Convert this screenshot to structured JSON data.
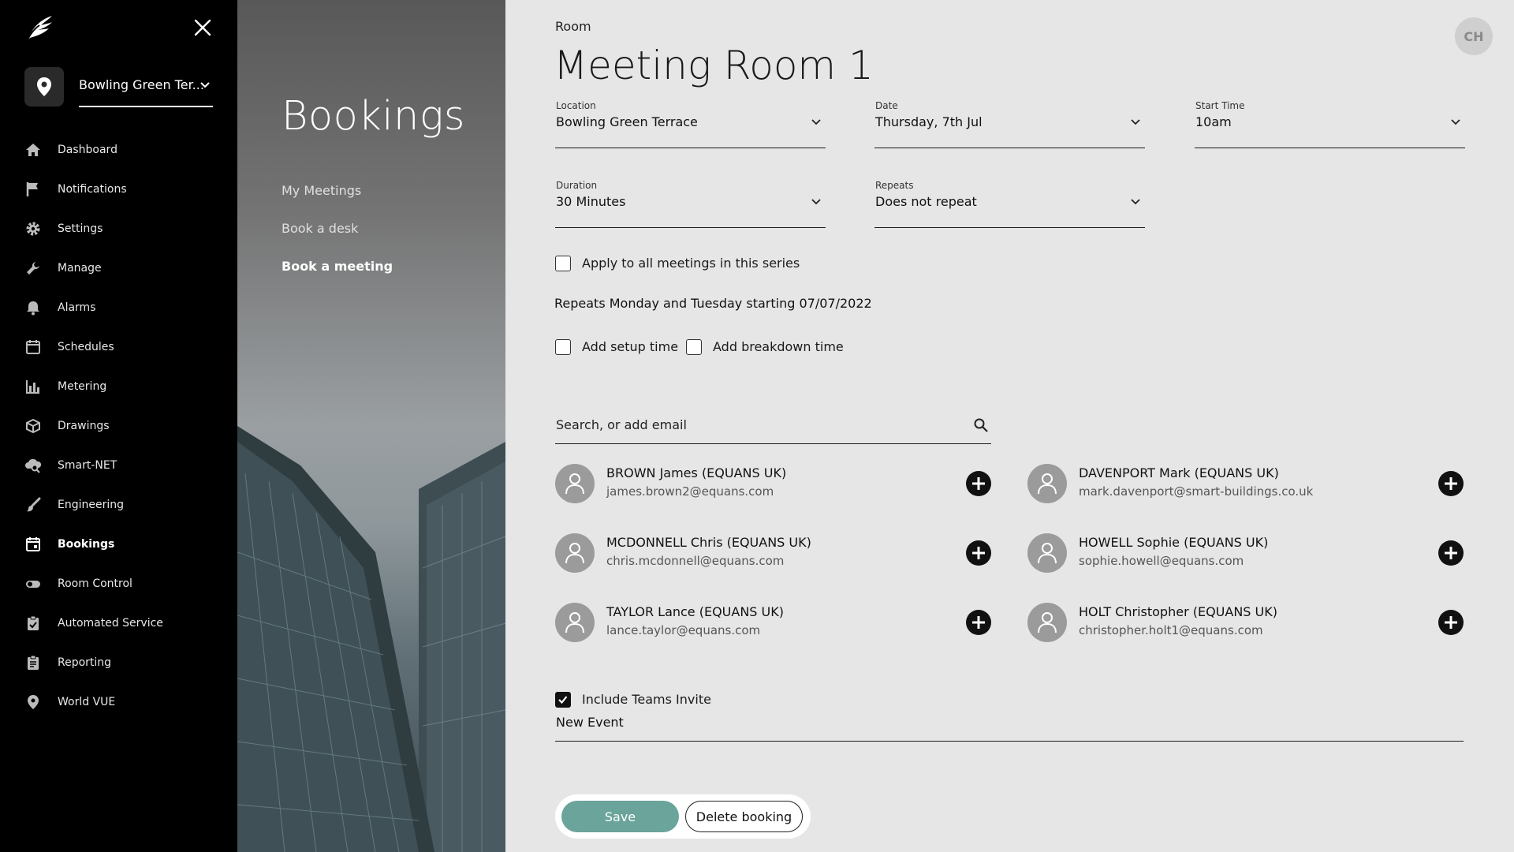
{
  "sidebar": {
    "location_selector": "Bowling Green Ter...",
    "nav": [
      {
        "label": "Dashboard",
        "icon": "home-icon"
      },
      {
        "label": "Notifications",
        "icon": "flag-icon"
      },
      {
        "label": "Settings",
        "icon": "gear-icon"
      },
      {
        "label": "Manage",
        "icon": "wrench-icon"
      },
      {
        "label": "Alarms",
        "icon": "bell-icon"
      },
      {
        "label": "Schedules",
        "icon": "calendar-icon"
      },
      {
        "label": "Metering",
        "icon": "bar-chart-icon"
      },
      {
        "label": "Drawings",
        "icon": "cube-icon"
      },
      {
        "label": "Smart-NET",
        "icon": "cloud-search-icon"
      },
      {
        "label": "Engineering",
        "icon": "brush-icon"
      },
      {
        "label": "Bookings",
        "icon": "calendar-event-icon",
        "active": true
      },
      {
        "label": "Room Control",
        "icon": "toggle-icon"
      },
      {
        "label": "Automated Service",
        "icon": "clipboard-icon"
      },
      {
        "label": "Reporting",
        "icon": "report-icon"
      },
      {
        "label": "World VUE",
        "icon": "map-pin-icon"
      }
    ]
  },
  "bookings_panel": {
    "title": "Bookings",
    "items": [
      {
        "label": "My Meetings"
      },
      {
        "label": "Book a desk"
      },
      {
        "label": "Book a meeting",
        "active": true
      }
    ]
  },
  "form": {
    "room_label": "Room",
    "room_title": "Meeting Room 1",
    "user_initials": "CH",
    "location": {
      "label": "Location",
      "value": "Bowling Green Terrace"
    },
    "date": {
      "label": "Date",
      "value": "Thursday, 7th Jul"
    },
    "start_time": {
      "label": "Start Time",
      "value": "10am"
    },
    "duration": {
      "label": "Duration",
      "value": "30 Minutes"
    },
    "repeats": {
      "label": "Repeats",
      "value": "Does not repeat"
    },
    "apply_series": {
      "label": "Apply to all meetings in this series",
      "checked": false
    },
    "repeat_summary": "Repeats Monday and Tuesday starting 07/07/2022",
    "setup_time": {
      "label": "Add setup time",
      "checked": false
    },
    "breakdown_time": {
      "label": "Add breakdown time",
      "checked": false
    },
    "search_placeholder": "Search, or add email",
    "attendees": [
      {
        "name": "BROWN James (EQUANS UK)",
        "email": "james.brown2@equans.com"
      },
      {
        "name": "DAVENPORT Mark (EQUANS UK)",
        "email": "mark.davenport@smart-buildings.co.uk"
      },
      {
        "name": "MCDONNELL Chris (EQUANS UK)",
        "email": "chris.mcdonnell@equans.com"
      },
      {
        "name": "HOWELL Sophie (EQUANS UK)",
        "email": "sophie.howell@equans.com"
      },
      {
        "name": "TAYLOR Lance (EQUANS UK)",
        "email": "lance.taylor@equans.com"
      },
      {
        "name": "HOLT Christopher (EQUANS UK)",
        "email": "christopher.holt1@equans.com"
      }
    ],
    "teams_invite": {
      "label": "Include Teams Invite",
      "checked": true
    },
    "event_name": "New Event",
    "save_label": "Save",
    "delete_label": "Delete booking"
  },
  "colors": {
    "sidebar_bg": "#000000",
    "main_bg": "#e6e6e6",
    "save_button": "#6aa49a",
    "avatar_grey": "#9b9b9b"
  }
}
